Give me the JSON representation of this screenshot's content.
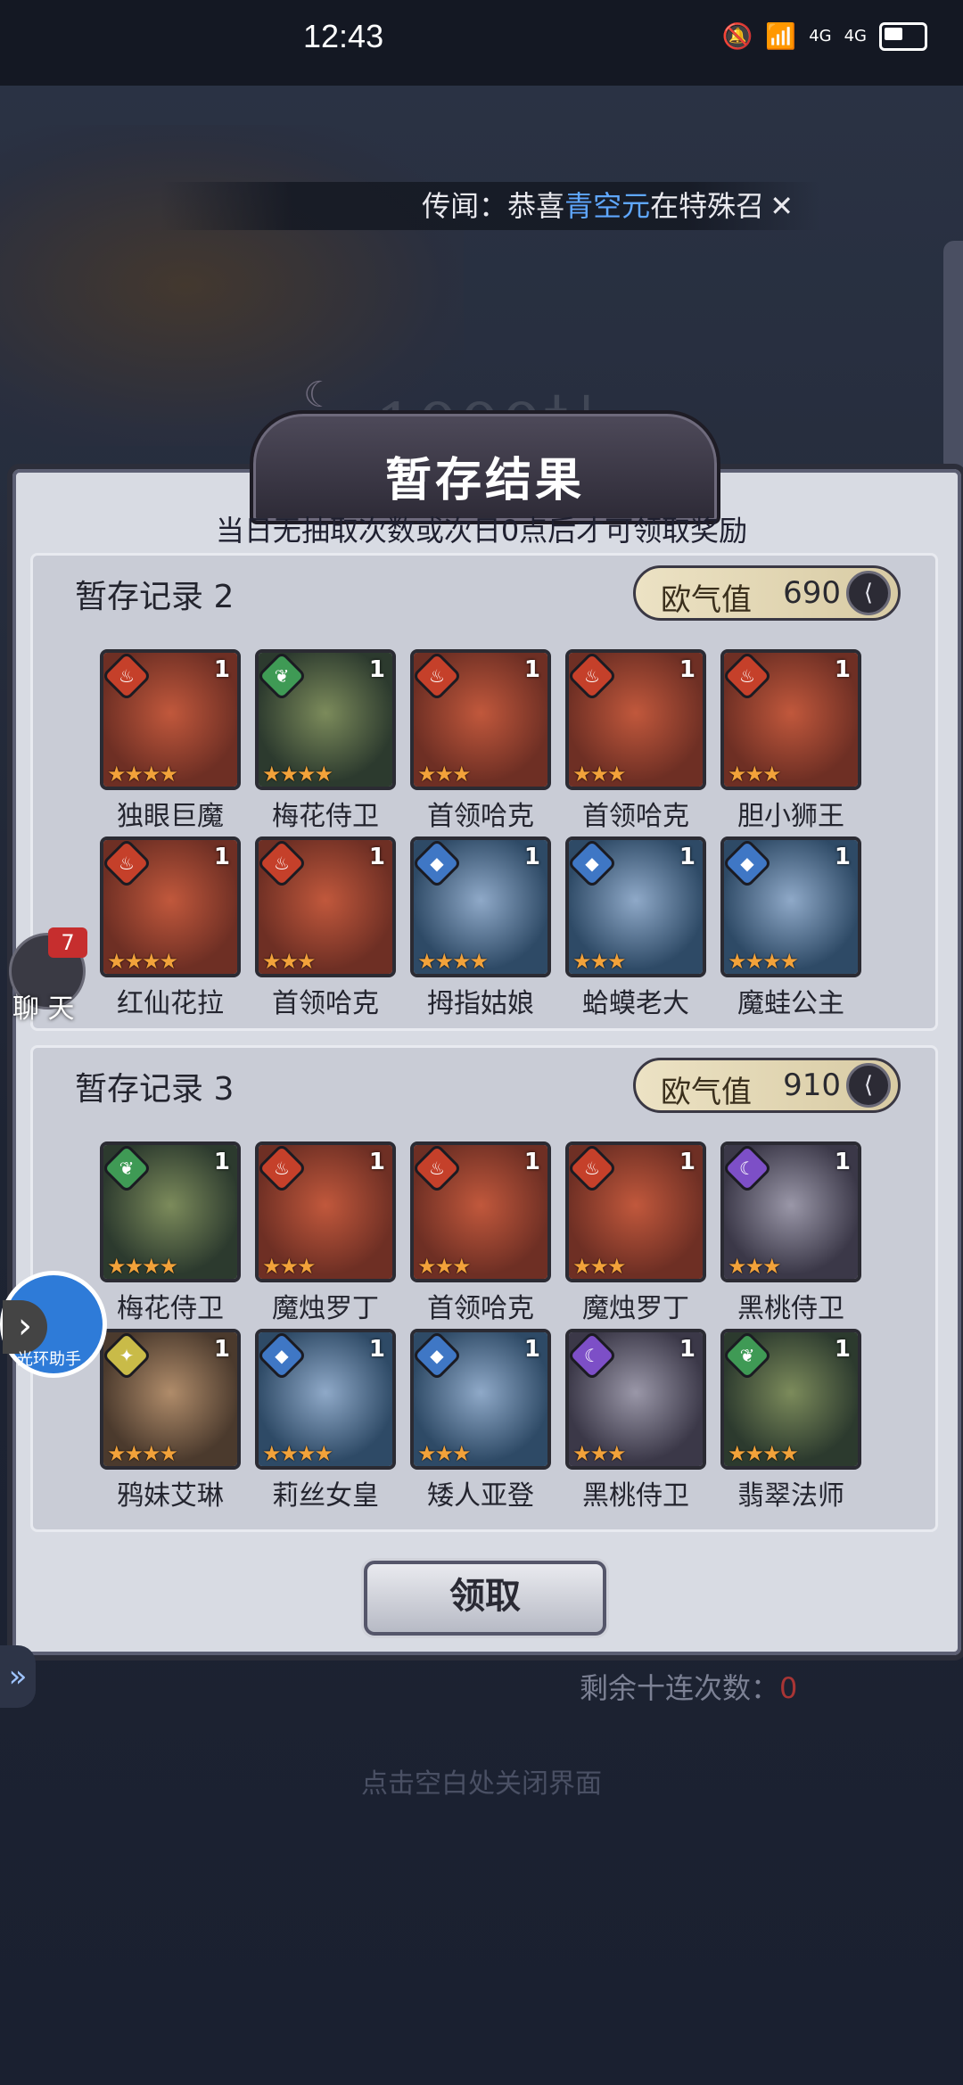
{
  "status_bar": {
    "time": "12:43",
    "signal_label_1": "4G",
    "signal_label_2": "4G"
  },
  "banner": {
    "prefix": "传闻：恭喜",
    "highlight": "青空元",
    "suffix": "在特殊召"
  },
  "background_title": "1000抽",
  "panel": {
    "title": "暂存结果",
    "notice": "当日无抽取次数或次日0点后才可领取奖励"
  },
  "records": [
    {
      "title": "暂存记录 2",
      "luck_label": "欧气值",
      "luck_value": "690",
      "heroes": [
        {
          "name": "独眼巨魔",
          "count": "1",
          "element": "fire",
          "stars": 4
        },
        {
          "name": "梅花侍卫",
          "count": "1",
          "element": "leaf",
          "stars": 4
        },
        {
          "name": "首领哈克",
          "count": "1",
          "element": "fire",
          "stars": 3
        },
        {
          "name": "首领哈克",
          "count": "1",
          "element": "fire",
          "stars": 3
        },
        {
          "name": "胆小狮王",
          "count": "1",
          "element": "fire",
          "stars": 3
        },
        {
          "name": "红仙花拉",
          "count": "1",
          "element": "fire",
          "stars": 4
        },
        {
          "name": "首领哈克",
          "count": "1",
          "element": "fire",
          "stars": 3
        },
        {
          "name": "拇指姑娘",
          "count": "1",
          "element": "water",
          "stars": 4
        },
        {
          "name": "蛤蟆老大",
          "count": "1",
          "element": "water",
          "stars": 3
        },
        {
          "name": "魔蛙公主",
          "count": "1",
          "element": "water",
          "stars": 4
        }
      ]
    },
    {
      "title": "暂存记录 3",
      "luck_label": "欧气值",
      "luck_value": "910",
      "heroes": [
        {
          "name": "梅花侍卫",
          "count": "1",
          "element": "leaf",
          "stars": 4
        },
        {
          "name": "魔烛罗丁",
          "count": "1",
          "element": "fire",
          "stars": 3
        },
        {
          "name": "首领哈克",
          "count": "1",
          "element": "fire",
          "stars": 3
        },
        {
          "name": "魔烛罗丁",
          "count": "1",
          "element": "fire",
          "stars": 3
        },
        {
          "name": "黑桃侍卫",
          "count": "1",
          "element": "moon",
          "stars": 3
        },
        {
          "name": "鸦妹艾琳",
          "count": "1",
          "element": "light",
          "stars": 4
        },
        {
          "name": "莉丝女皇",
          "count": "1",
          "element": "water",
          "stars": 4
        },
        {
          "name": "矮人亚登",
          "count": "1",
          "element": "water",
          "stars": 3
        },
        {
          "name": "黑桃侍卫",
          "count": "1",
          "element": "moon",
          "stars": 3
        },
        {
          "name": "翡翠法师",
          "count": "1",
          "element": "leaf",
          "stars": 4
        }
      ]
    }
  ],
  "claim_button": "领取",
  "remaining_label": "剩余十连次数：",
  "remaining_value": "0",
  "close_hint": "点击空白处关闭界面",
  "chat": {
    "badge": "7",
    "label": "聊 天"
  },
  "helper": {
    "label": "光环助手"
  },
  "colors": {
    "fire": "#c5402a",
    "leaf": "#3f9a55",
    "water": "#3f77c5",
    "moon": "#7d4fc7",
    "light": "#c9bb48"
  },
  "icons": {
    "fire": "fire-icon",
    "leaf": "leaf-icon",
    "water": "water-drop-icon",
    "moon": "moon-icon",
    "light": "light-icon"
  }
}
